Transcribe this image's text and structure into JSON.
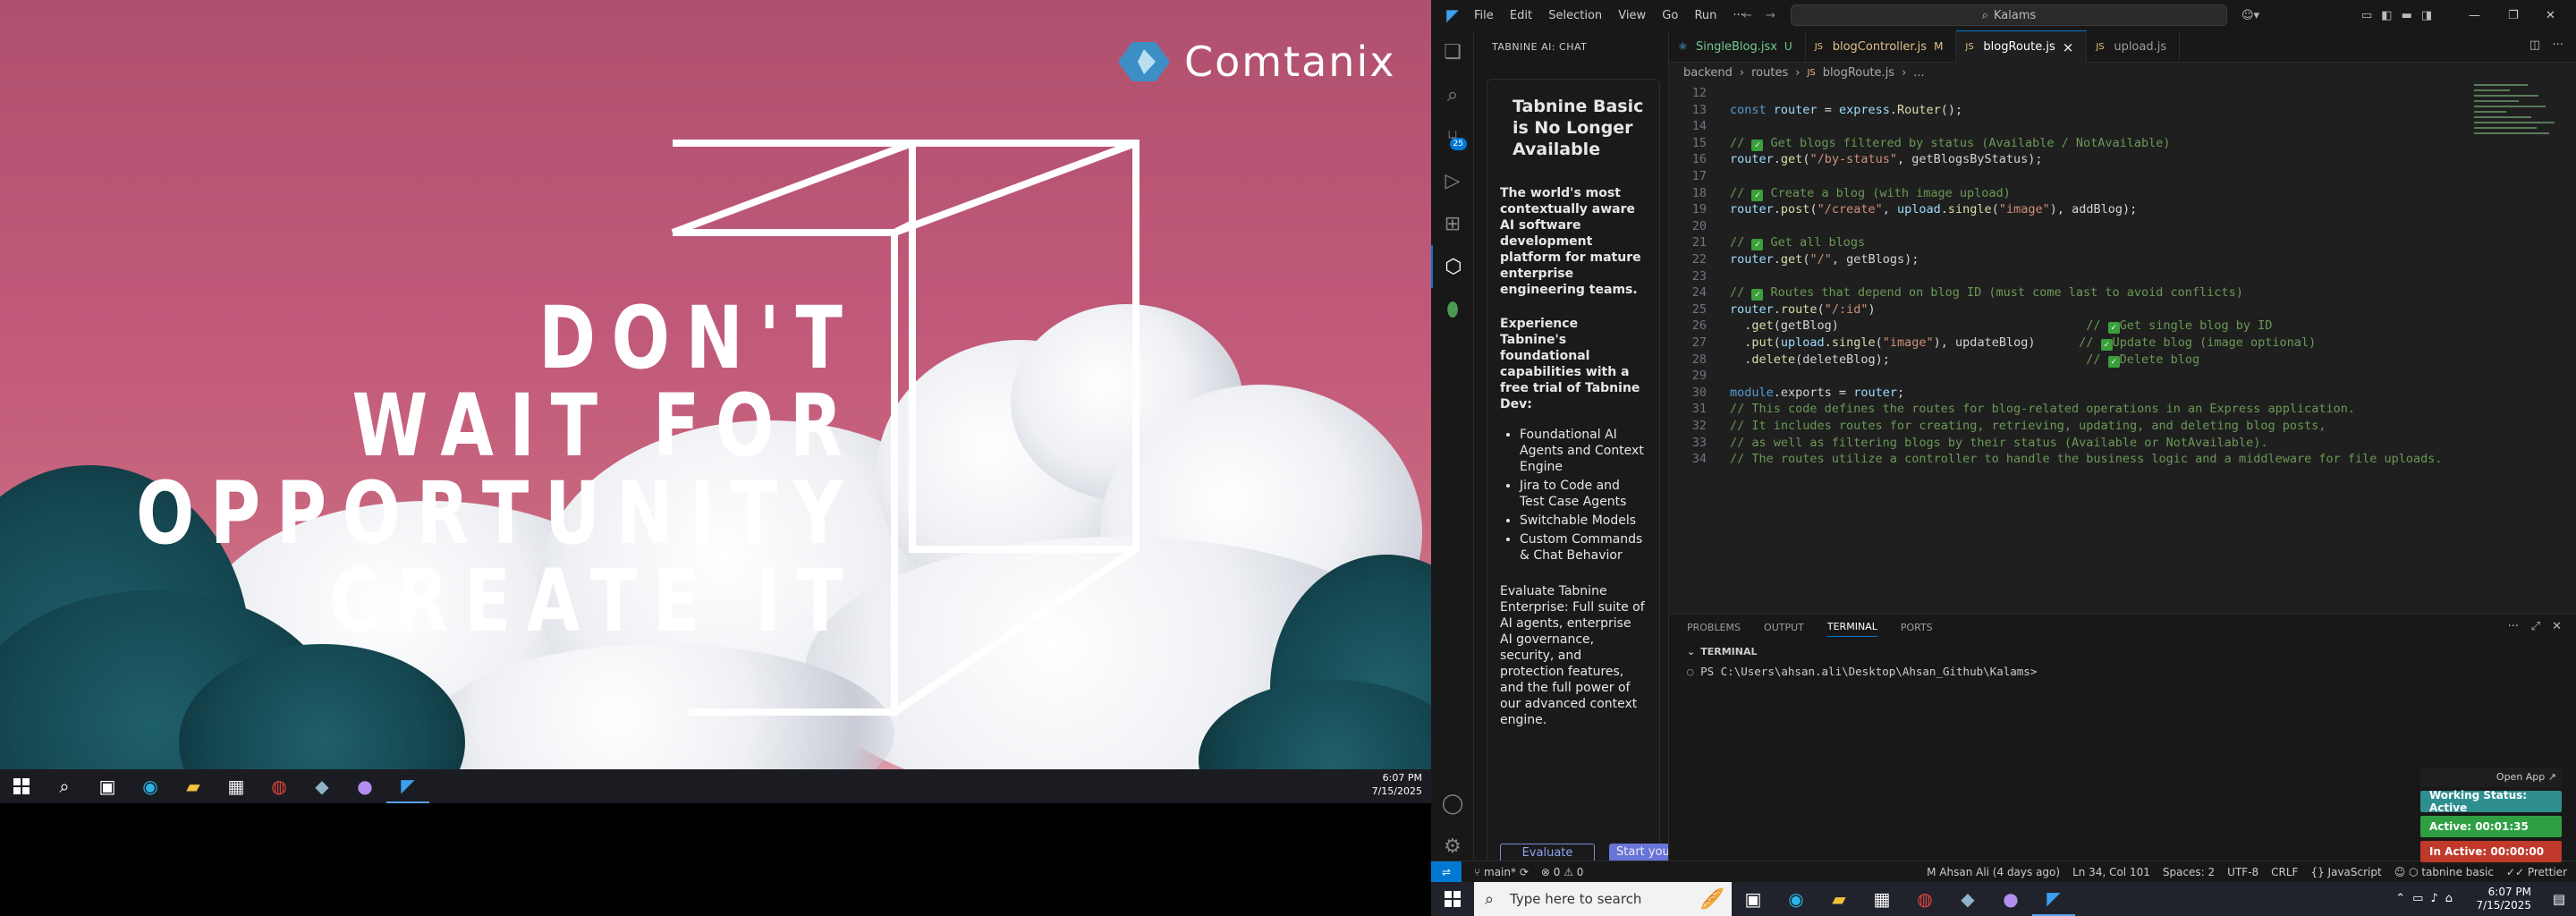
{
  "wallpaper": {
    "brand": "Comtanix",
    "quote_lines": [
      "DON'T",
      "WAIT FOR",
      "OPPORTUNITY",
      "CREATE IT"
    ]
  },
  "left_taskbar": {
    "time": "6:07 PM",
    "date": "7/15/2025"
  },
  "vscode": {
    "menu": [
      "File",
      "Edit",
      "Selection",
      "View",
      "Go",
      "Run",
      "···"
    ],
    "search": "Kalams",
    "activity_badge": "25",
    "sidebar_title": "TABNINE AI: CHAT",
    "card": {
      "heading": "Tabnine Basic is No Longer Available",
      "intro": "The world's most contextually aware AI software development platform for mature enterprise engineering teams.",
      "trial": "Experience Tabnine's foundational capabilities with a free trial of Tabnine Dev:",
      "features": [
        "Foundational AI Agents and Context Engine",
        "Jira to Code and Test Case Agents",
        "Switchable Models",
        "Custom Commands & Chat Behavior"
      ],
      "enterprise": "Evaluate Tabnine Enterprise: Full suite of AI agents, enterprise AI governance, security, and protection features, and the full power of our advanced context engine.",
      "btn_evaluate": "Evaluate enterprise",
      "btn_start": "Start your Dev trial"
    },
    "tabs": [
      {
        "label": "SingleBlog.jsx",
        "mod": "U",
        "icon": "⚛",
        "color": "#4fc1ff"
      },
      {
        "label": "blogController.js",
        "mod": "M",
        "icon": "JS",
        "color": "#e5c07b"
      },
      {
        "label": "blogRoute.js",
        "mod": "×",
        "icon": "JS",
        "color": "#e5c07b"
      },
      {
        "label": "upload.js",
        "mod": "",
        "icon": "JS",
        "color": "#e5c07b"
      }
    ],
    "breadcrumb": [
      "backend",
      "routes",
      "blogRoute.js",
      "..."
    ],
    "code": [
      {
        "n": "12",
        "t": ""
      },
      {
        "n": "13",
        "t": "const router = express.Router();"
      },
      {
        "n": "14",
        "t": ""
      },
      {
        "n": "15",
        "t": "// ✅ Get blogs filtered by status (Available / NotAvailable)"
      },
      {
        "n": "16",
        "t": "router.get(\"/by-status\", getBlogsByStatus);"
      },
      {
        "n": "17",
        "t": ""
      },
      {
        "n": "18",
        "t": "// ✅ Create a blog (with image upload)"
      },
      {
        "n": "19",
        "t": "router.post(\"/create\", upload.single(\"image\"), addBlog);"
      },
      {
        "n": "20",
        "t": ""
      },
      {
        "n": "21",
        "t": "// ✅ Get all blogs"
      },
      {
        "n": "22",
        "t": "router.get(\"/\", getBlogs);"
      },
      {
        "n": "23",
        "t": ""
      },
      {
        "n": "24",
        "t": "// ✅ Routes that depend on blog ID (must come last to avoid conflicts)"
      },
      {
        "n": "25",
        "t": "router.route(\"/:id\")"
      },
      {
        "n": "26",
        "t": "  .get(getBlog)                                  // ✅Get single blog by ID"
      },
      {
        "n": "27",
        "t": "  .put(upload.single(\"image\"), updateBlog)      // ✅Update blog (image optional)"
      },
      {
        "n": "28",
        "t": "  .delete(deleteBlog);                           // ✅Delete blog"
      },
      {
        "n": "29",
        "t": ""
      },
      {
        "n": "30",
        "t": "module.exports = router;"
      },
      {
        "n": "31",
        "t": "// This code defines the routes for blog-related operations in an Express application."
      },
      {
        "n": "32",
        "t": "// It includes routes for creating, retrieving, updating, and deleting blog posts,"
      },
      {
        "n": "33",
        "t": "// as well as filtering blogs by their status (Available or NotAvailable)."
      },
      {
        "n": "34",
        "t": "// The routes utilize a controller to handle the business logic and a middleware for file uploads."
      }
    ],
    "panel_tabs": [
      "PROBLEMS",
      "OUTPUT",
      "TERMINAL",
      "PORTS"
    ],
    "terminal_header": "TERMINAL",
    "terminal_prompt": "PS C:\\Users\\ahsan.ali\\Desktop\\Ahsan_Github\\Kalams>",
    "status": {
      "branch": "main*",
      "problems": "⊗ 0 ⚠ 0",
      "author": "M Ahsan Ali (4 days ago)",
      "position": "Ln 34, Col 101",
      "spaces": "Spaces: 2",
      "encoding": "UTF-8",
      "eol": "CRLF",
      "language": "{} JavaScript",
      "tabnine": "tabnine basic",
      "prettier": "Prettier"
    }
  },
  "work_status": {
    "open": "Open App ↗",
    "status": "Working Status: Active",
    "active": "Active: 00:01:35",
    "inactive": "In Active: 00:00:00",
    "colors": {
      "status": "#2f8f8f",
      "active": "#2ea043",
      "inactive": "#c0392b"
    }
  },
  "right_taskbar": {
    "search_placeholder": "Type here to search",
    "time": "6:07 PM",
    "date": "7/15/2025"
  }
}
